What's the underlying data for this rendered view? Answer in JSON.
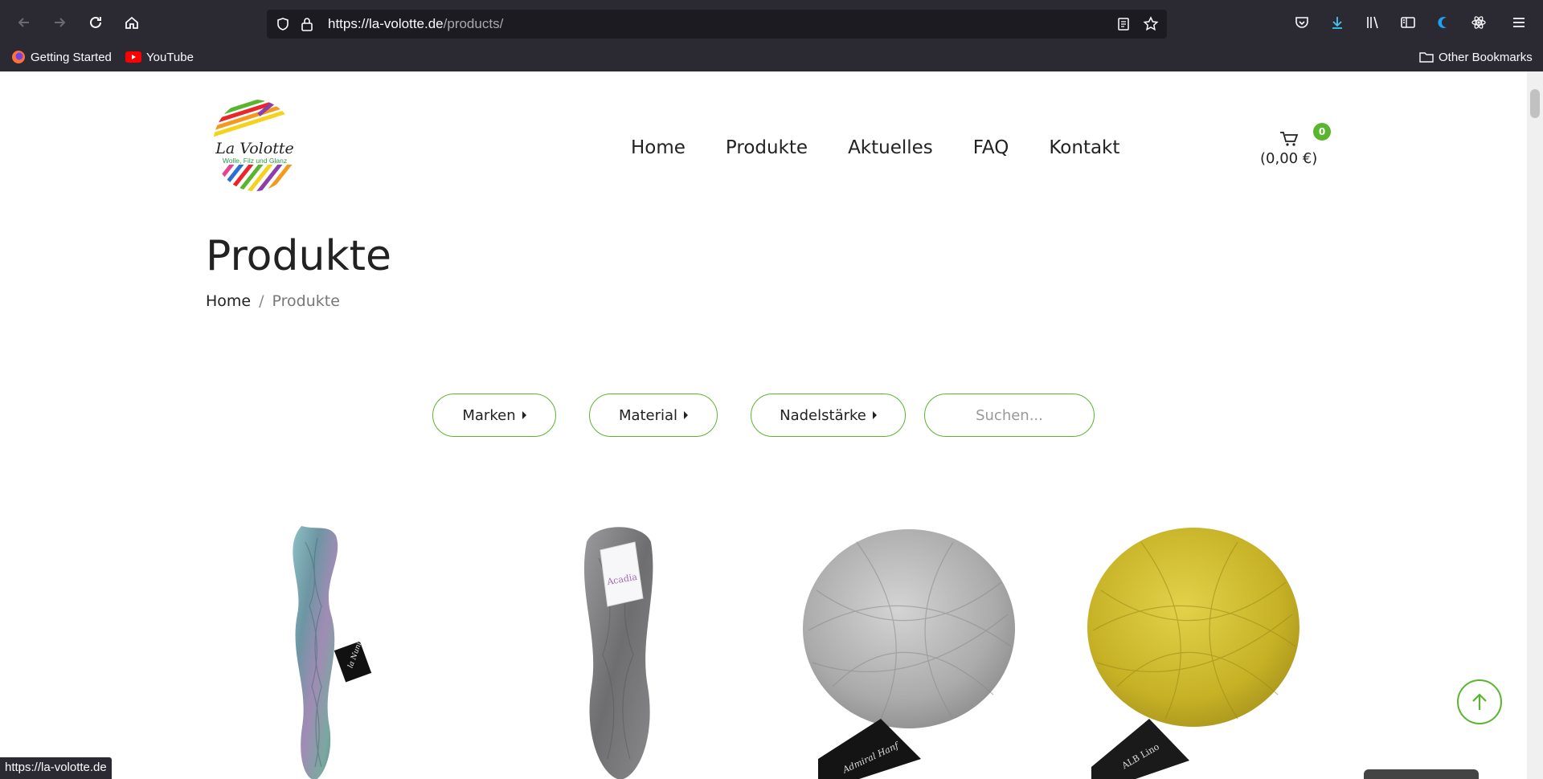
{
  "browser": {
    "url_domain": "https://la-volotte.de",
    "url_path": "/products/",
    "bookmarks": [
      {
        "label": "Getting Started"
      },
      {
        "label": "YouTube"
      }
    ],
    "other_bookmarks": "Other Bookmarks",
    "status_url": "https://la-volotte.de"
  },
  "site": {
    "logo": {
      "name": "La Volotte",
      "tagline": "Wolle, Filz und Glanz"
    },
    "nav": [
      "Home",
      "Produkte",
      "Aktuelles",
      "FAQ",
      "Kontakt"
    ],
    "cart": {
      "count": "0",
      "total": "(0,00 €)"
    }
  },
  "page": {
    "title": "Produkte",
    "breadcrumb": {
      "home": "Home",
      "separator": "/",
      "current": "Produkte"
    }
  },
  "filters": {
    "brands": "Marken",
    "material": "Material",
    "needle_size": "Nadelstärke",
    "search_placeholder": "Suchen..."
  },
  "products": [
    {
      "label_text": "la Nunie",
      "yarn_color": "#7fa8b0"
    },
    {
      "label_text": "Acadia",
      "yarn_color": "#7b7b7d"
    },
    {
      "label_text": "Admiral Hanf",
      "yarn_color": "#b5b5b5"
    },
    {
      "label_text": "ALB Lino",
      "yarn_color": "#c9b52a"
    }
  ],
  "colors": {
    "accent": "#5ab52e",
    "text": "#222222",
    "chrome": "#2b2a33"
  }
}
